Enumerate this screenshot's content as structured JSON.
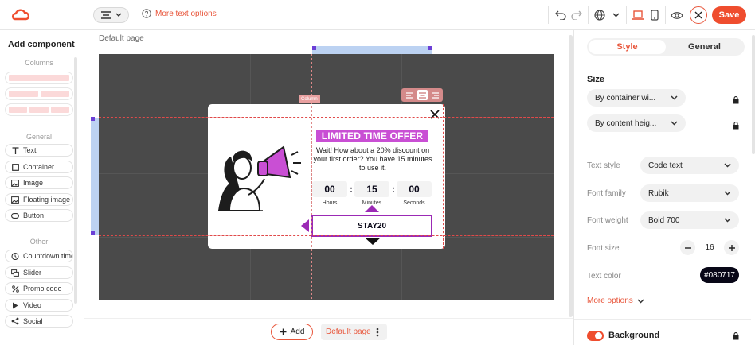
{
  "toolbar": {
    "more_text_options": "More text options",
    "save_label": "Save",
    "colors": {
      "accent": "#ef4d2e",
      "accent_text": "#e8553a"
    }
  },
  "left_panel": {
    "title": "Add component",
    "columns_label": "Columns",
    "general_label": "General",
    "general_items": [
      {
        "label": "Text",
        "icon": "text-icon"
      },
      {
        "label": "Container",
        "icon": "container-icon"
      },
      {
        "label": "Image",
        "icon": "image-icon"
      },
      {
        "label": "Floating image",
        "icon": "floating-image-icon"
      },
      {
        "label": "Button",
        "icon": "button-icon"
      }
    ],
    "other_label": "Other",
    "other_items": [
      {
        "label": "Countdown timer",
        "icon": "countdown-icon"
      },
      {
        "label": "Slider",
        "icon": "slider-icon"
      },
      {
        "label": "Promo code",
        "icon": "percent-icon"
      },
      {
        "label": "Video",
        "icon": "play-icon"
      },
      {
        "label": "Social",
        "icon": "share-icon"
      }
    ]
  },
  "canvas": {
    "page_label": "Default page",
    "column_tag": "Column",
    "popup": {
      "title": "LIMITED TIME OFFER",
      "body": "Wait! How about a 20% discount on your first order? You have 15 minutes to use it.",
      "countdown": [
        {
          "value": "00",
          "label": "Hours"
        },
        {
          "value": "15",
          "label": "Minutes"
        },
        {
          "value": "00",
          "label": "Seconds"
        }
      ],
      "countdown_separator": ":",
      "promo_code": "STAY20"
    }
  },
  "bottom_bar": {
    "add_label": "Add",
    "page_label": "Default page"
  },
  "right_panel": {
    "tabs": [
      {
        "label": "Style",
        "active": true
      },
      {
        "label": "General",
        "active": false
      }
    ],
    "size_heading": "Size",
    "width_mode": "By container wi...",
    "height_mode": "By content heig...",
    "text_style_label": "Text style",
    "text_style_value": "Code text",
    "font_family_label": "Font family",
    "font_family_value": "Rubik",
    "font_weight_label": "Font weight",
    "font_weight_value": "Bold 700",
    "font_size_label": "Font size",
    "font_size_value": "16",
    "text_color_label": "Text color",
    "text_color_value": "#080717",
    "more_options": "More options",
    "background_label": "Background",
    "background_enabled": true
  }
}
